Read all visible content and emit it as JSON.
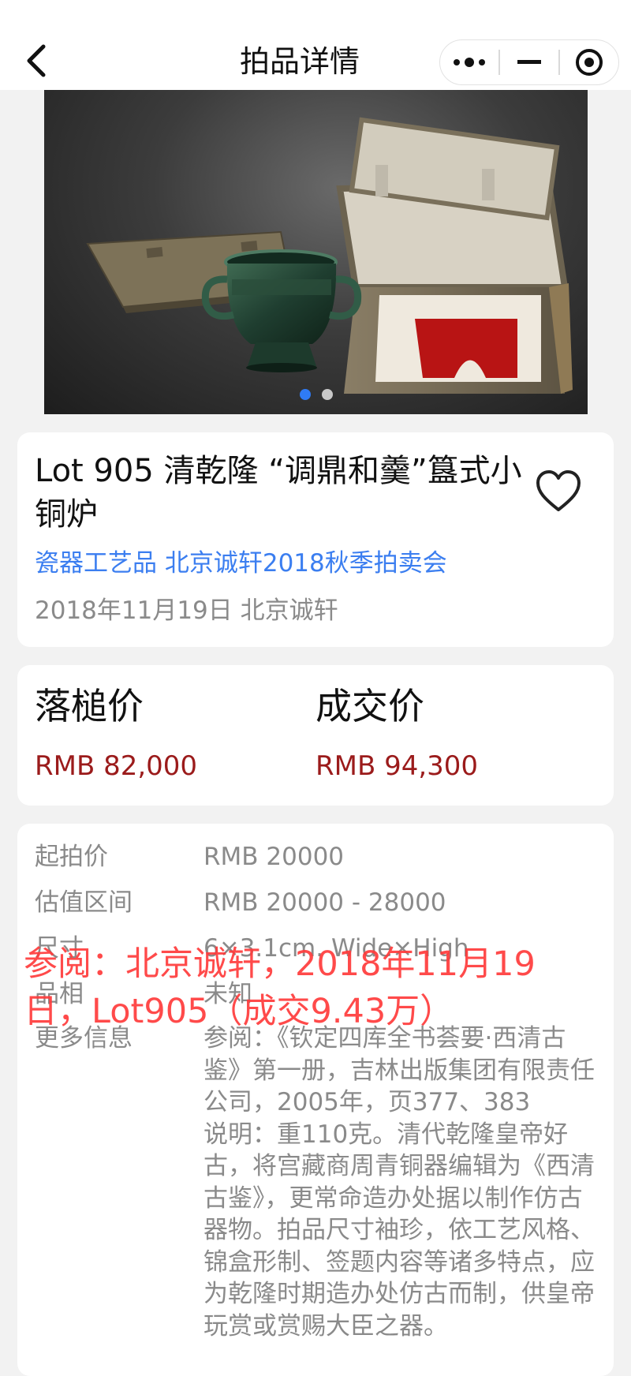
{
  "header": {
    "title": "拍品详情"
  },
  "lot": {
    "title": "Lot 905 清乾隆 “调鼎和羹”簋式小铜炉",
    "category_link": "瓷器工艺品 北京诚轩2018秋季拍卖会",
    "meta": "2018年11月19日 北京诚轩"
  },
  "prices": {
    "hammer_label": "落槌价",
    "hammer_value": "RMB 82,000",
    "deal_label": "成交价",
    "deal_value": "RMB 94,300"
  },
  "info": {
    "start_label": "起拍价",
    "start_value": "RMB 20000",
    "estimate_label": "估值区间",
    "estimate_value": "RMB 20000 - 28000",
    "size_label": "尺寸",
    "size_value": "6×3.1cm. Wide×High",
    "condition_label": "品相",
    "condition_value": "未知",
    "more_label": "更多信息",
    "more_value": "参阅：《钦定四库全书荟要·西清古鉴》第一册，吉林出版集团有限责任公司，2005年，页377、383\n说明：重110克。清代乾隆皇帝好古，将宫藏商周青铜器编辑为《西清古鉴》，更常命造办处据以制作仿古器物。拍品尺寸袖珍，依工艺风格、锦盒形制、签题内容等诸多特点，应为乾隆时期造办处仿古而制，供皇帝玩赏或赏赐大臣之器。"
  },
  "overlay": {
    "text": "参阅：北京诚轩，2018年11月19日，Lot905（成交9.43万）"
  },
  "carousel": {
    "count": 2,
    "active": 0
  },
  "icons": {
    "back": "chevron-left-icon",
    "more": "more-dots-icon",
    "minimize": "minus-icon",
    "close": "target-icon",
    "favorite": "heart-outline-icon"
  },
  "colors": {
    "link": "#3b7ef0",
    "price": "#9b1b1b",
    "overlay": "#ff3b3b",
    "dot_active": "#2f7bf5"
  }
}
